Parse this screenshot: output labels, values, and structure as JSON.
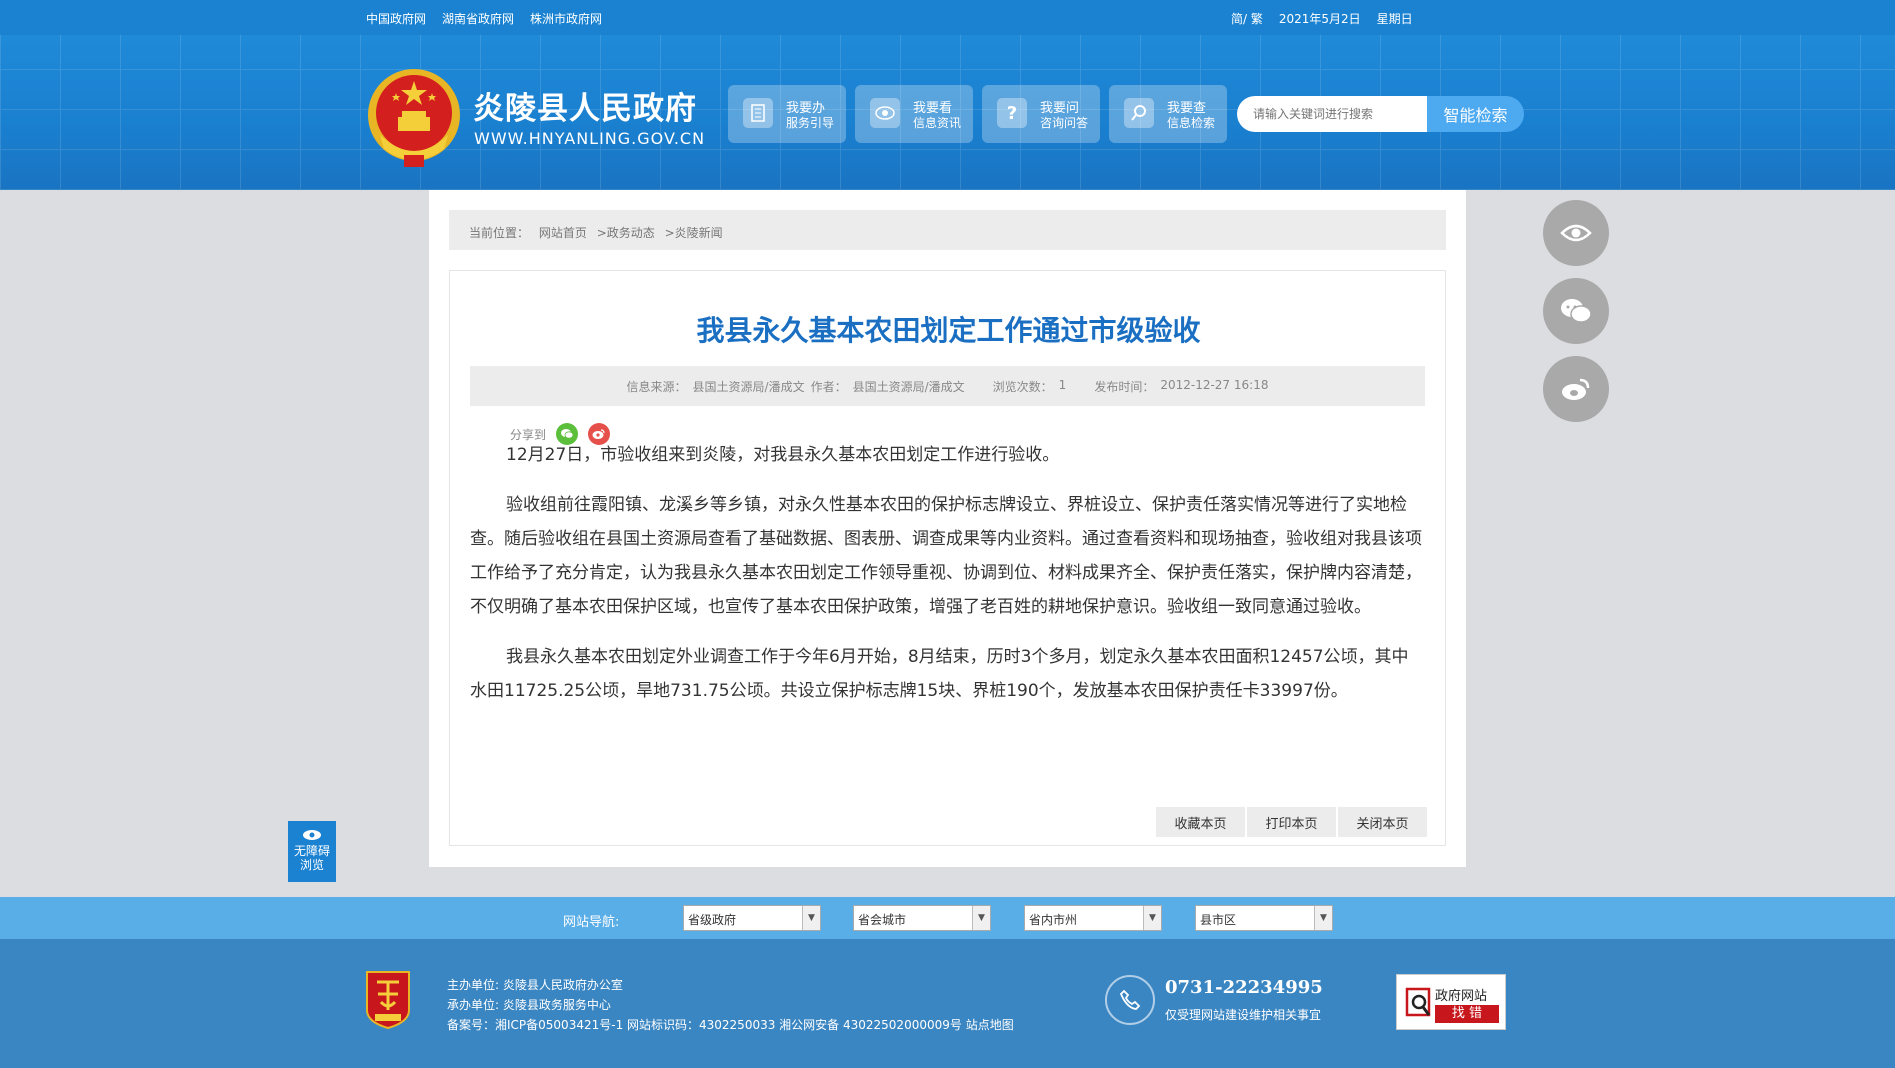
{
  "topbar": {
    "links": [
      "中国政府网",
      "湖南省政府网",
      "株洲市政府网"
    ],
    "lang": "简/ 繁",
    "date": "2021年5月2日",
    "weekday": "星期日"
  },
  "header": {
    "site_name": "炎陵县人民政府",
    "site_url": "WWW.HNYANLING.GOV.CN",
    "services": [
      {
        "line1": "我要办",
        "line2": "服务引导",
        "icon": "document-icon"
      },
      {
        "line1": "我要看",
        "line2": "信息资讯",
        "icon": "eye-icon"
      },
      {
        "line1": "我要问",
        "line2": "咨询问答",
        "icon": "question-icon"
      },
      {
        "line1": "我要查",
        "line2": "信息检索",
        "icon": "search-icon"
      }
    ],
    "search_placeholder": "请输入关键词进行搜索",
    "search_button": "智能检索"
  },
  "breadcrumb": {
    "label": "当前位置：",
    "items": [
      "网站首页",
      ">政务动态",
      ">炎陵新闻"
    ]
  },
  "article": {
    "title": "我县永久基本农田划定工作通过市级验收",
    "meta": {
      "source_label": "信息来源：",
      "source": "县国土资源局/潘成文",
      "author_label": "作者：",
      "author": "县国土资源局/潘成文",
      "views_label": "浏览次数：",
      "views": "1",
      "date_label": "发布时间：",
      "date": "2012-12-27 16:18"
    },
    "share_label": "分享到",
    "paragraphs": [
      "12月27日，市验收组来到炎陵，对我县永久基本农田划定工作进行验收。",
      "验收组前往霞阳镇、龙溪乡等乡镇，对永久性基本农田的保护标志牌设立、界桩设立、保护责任落实情况等进行了实地检查。随后验收组在县国土资源局查看了基础数据、图表册、调查成果等内业资料。通过查看资料和现场抽查，验收组对我县该项工作给予了充分肯定，认为我县永久基本农田划定工作领导重视、协调到位、材料成果齐全、保护责任落实，保护牌内容清楚，不仅明确了基本农田保护区域，也宣传了基本农田保护政策，增强了老百姓的耕地保护意识。验收组一致同意通过验收。",
      "我县永久基本农田划定外业调查工作于今年6月开始，8月结束，历时3个多月，划定永久基本农田面积12457公顷，其中水田11725.25公顷，旱地731.75公顷。共设立保护标志牌15块、界桩190个，发放基本农田保护责任卡33997份。"
    ],
    "actions": [
      "收藏本页",
      "打印本页",
      "关闭本页"
    ]
  },
  "accessibility": {
    "line1": "无障碍",
    "line2": "浏览"
  },
  "site_nav": {
    "label": "网站导航:",
    "selects": [
      "省级政府",
      "省会城市",
      "省内市州",
      "县市区"
    ]
  },
  "footer": {
    "host_label": "主办单位:",
    "host": "炎陵县人民政府办公室",
    "organizer_label": "承办单位:",
    "organizer": "炎陵县政务服务中心",
    "record": "备案号：湘ICP备05003421号-1 网站标识码：4302250033 湘公网安备 43022502000009号 站点地图",
    "phone": "0731-22234995",
    "phone_note": "仅受理网站建设维护相关事宜",
    "report_line1": "政府网站",
    "report_line2": "找 错"
  },
  "colors": {
    "brand_blue": "#1a82d1",
    "title_blue": "#1a6fc2",
    "footer_blue": "#3a86c3",
    "report_red": "#c8161d"
  }
}
